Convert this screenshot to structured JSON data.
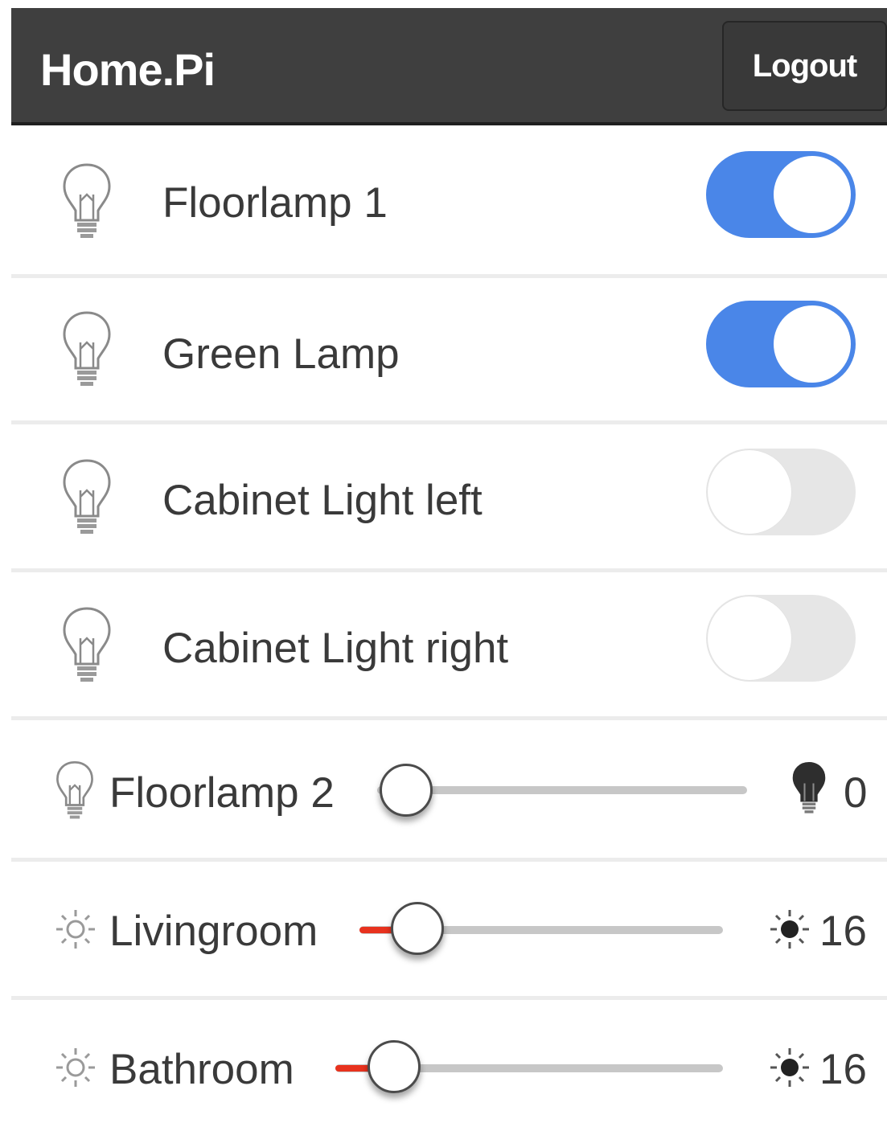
{
  "header": {
    "title": "Home.Pi",
    "logout_label": "Logout"
  },
  "switches": [
    {
      "name": "Floorlamp 1",
      "state": "on",
      "icon": "lightbulb-outline-icon"
    },
    {
      "name": "Green Lamp",
      "state": "on",
      "icon": "lightbulb-outline-icon"
    },
    {
      "name": "Cabinet Light left",
      "state": "off",
      "icon": "lightbulb-outline-icon"
    },
    {
      "name": "Cabinet Light right",
      "state": "off",
      "icon": "lightbulb-outline-icon"
    }
  ],
  "dimmers": [
    {
      "name": "Floorlamp 2",
      "value": "0",
      "level": 0,
      "icon": "lightbulb-outline-icon",
      "value_icon": "lightbulb-filled-icon"
    },
    {
      "name": "Livingroom",
      "value": "16",
      "level": 16,
      "icon": "sun-outline-icon",
      "value_icon": "sun-filled-icon"
    },
    {
      "name": "Bathroom",
      "value": "16",
      "level": 16,
      "icon": "sun-outline-icon",
      "value_icon": "sun-filled-icon"
    }
  ],
  "colors": {
    "header_bg": "#3f3f3f",
    "toggle_on": "#4a86e8",
    "toggle_off": "#e6e6e6",
    "slider_fill": "#e8321e"
  }
}
